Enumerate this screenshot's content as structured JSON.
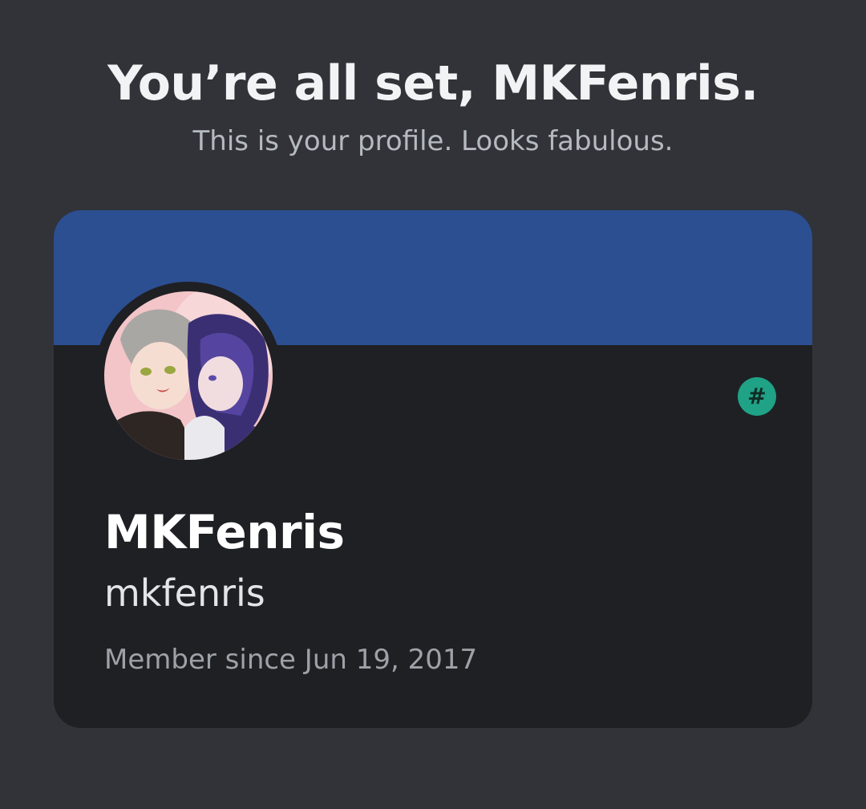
{
  "header": {
    "title": "You’re all set, MKFenris.",
    "subtitle": "This is your profile. Looks fabulous."
  },
  "profile_card": {
    "banner_color": "#2c4f92",
    "avatar_icon": "anime-avatar-image",
    "badge": {
      "icon": "hashtag-icon",
      "text": "#",
      "color": "#1fa286"
    },
    "display_name": "MKFenris",
    "username": "mkfenris",
    "member_since": "Member since Jun 19, 2017"
  }
}
